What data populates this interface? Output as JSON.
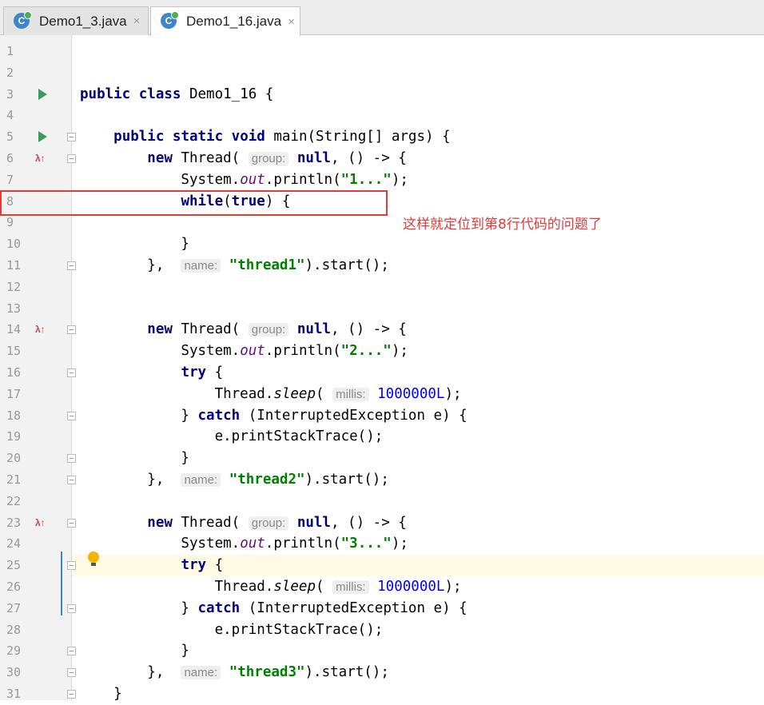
{
  "tabs": [
    {
      "label": "Demo1_3.java",
      "close": "×",
      "icon": "java-class-icon"
    },
    {
      "label": "Demo1_16.java",
      "close": "×",
      "icon": "java-class-icon",
      "active": true
    }
  ],
  "annotation": "这样就定位到第8行代码的问题了",
  "lines": [
    {
      "n": "1",
      "html": ""
    },
    {
      "n": "2",
      "html": ""
    },
    {
      "n": "3",
      "html": "<span class='kw'>public class</span> Demo1_16 {"
    },
    {
      "n": "4",
      "html": ""
    },
    {
      "n": "5",
      "html": "    <span class='kw'>public static void</span> main(String[] args) {"
    },
    {
      "n": "6",
      "html": "        <span class='kw'>new</span> Thread( <span class='hint'>group:</span> <span class='kw'>null</span>, () -> {"
    },
    {
      "n": "7",
      "html": "            System.<span class='it'>out</span>.println(<span class='str'>\"1...\"</span>);"
    },
    {
      "n": "8",
      "html": "            <span class='kw'>while</span>(<span class='kw'>true</span>) {"
    },
    {
      "n": "9",
      "html": ""
    },
    {
      "n": "10",
      "html": "            }"
    },
    {
      "n": "11",
      "html": "        },  <span class='hint'>name:</span> <span class='str'>\"thread1\"</span>).start();"
    },
    {
      "n": "12",
      "html": ""
    },
    {
      "n": "13",
      "html": ""
    },
    {
      "n": "14",
      "html": "        <span class='kw'>new</span> Thread( <span class='hint'>group:</span> <span class='kw'>null</span>, () -> {"
    },
    {
      "n": "15",
      "html": "            System.<span class='it'>out</span>.println(<span class='str'>\"2...\"</span>);"
    },
    {
      "n": "16",
      "html": "            <span class='kw'>try</span> {"
    },
    {
      "n": "17",
      "html": "                Thread.<span class='it' style='color:#000'>sleep</span>( <span class='hint'>millis:</span> <span class='num'>1000000L</span>);"
    },
    {
      "n": "18",
      "html": "            } <span class='kw'>catch</span> (InterruptedException e) {"
    },
    {
      "n": "19",
      "html": "                e.printStackTrace();"
    },
    {
      "n": "20",
      "html": "            }"
    },
    {
      "n": "21",
      "html": "        },  <span class='hint'>name:</span> <span class='str'>\"thread2\"</span>).start();"
    },
    {
      "n": "22",
      "html": ""
    },
    {
      "n": "23",
      "html": "        <span class='kw'>new</span> Thread( <span class='hint'>group:</span> <span class='kw'>null</span>, () -> {"
    },
    {
      "n": "24",
      "html": "            System.<span class='it'>out</span>.println(<span class='str'>\"3...\"</span>);"
    },
    {
      "n": "25",
      "html": "            <span class='kw'>try</span> {"
    },
    {
      "n": "26",
      "html": "                Thread.<span class='it' style='color:#000'>sleep</span>( <span class='hint'>millis:</span> <span class='num'>1000000L</span>);"
    },
    {
      "n": "27",
      "html": "            } <span class='kw'>catch</span> (InterruptedException e) {"
    },
    {
      "n": "28",
      "html": "                e.printStackTrace();"
    },
    {
      "n": "29",
      "html": "            }"
    },
    {
      "n": "30",
      "html": "        },  <span class='hint'>name:</span> <span class='str'>\"thread3\"</span>).start();"
    },
    {
      "n": "31",
      "html": "    }"
    }
  ],
  "run_lines": [
    "3",
    "5"
  ],
  "override_lines": [
    "6",
    "14",
    "23"
  ],
  "fold_lines": [
    "5",
    "6",
    "11",
    "14",
    "16",
    "18",
    "20",
    "21",
    "23",
    "25",
    "27",
    "29",
    "30",
    "31"
  ],
  "current_line": "25",
  "icons": {
    "run": "run-gutter-icon",
    "override": "lambda-override-icon",
    "fold": "fold-marker-icon",
    "bulb": "intention-bulb-icon"
  }
}
